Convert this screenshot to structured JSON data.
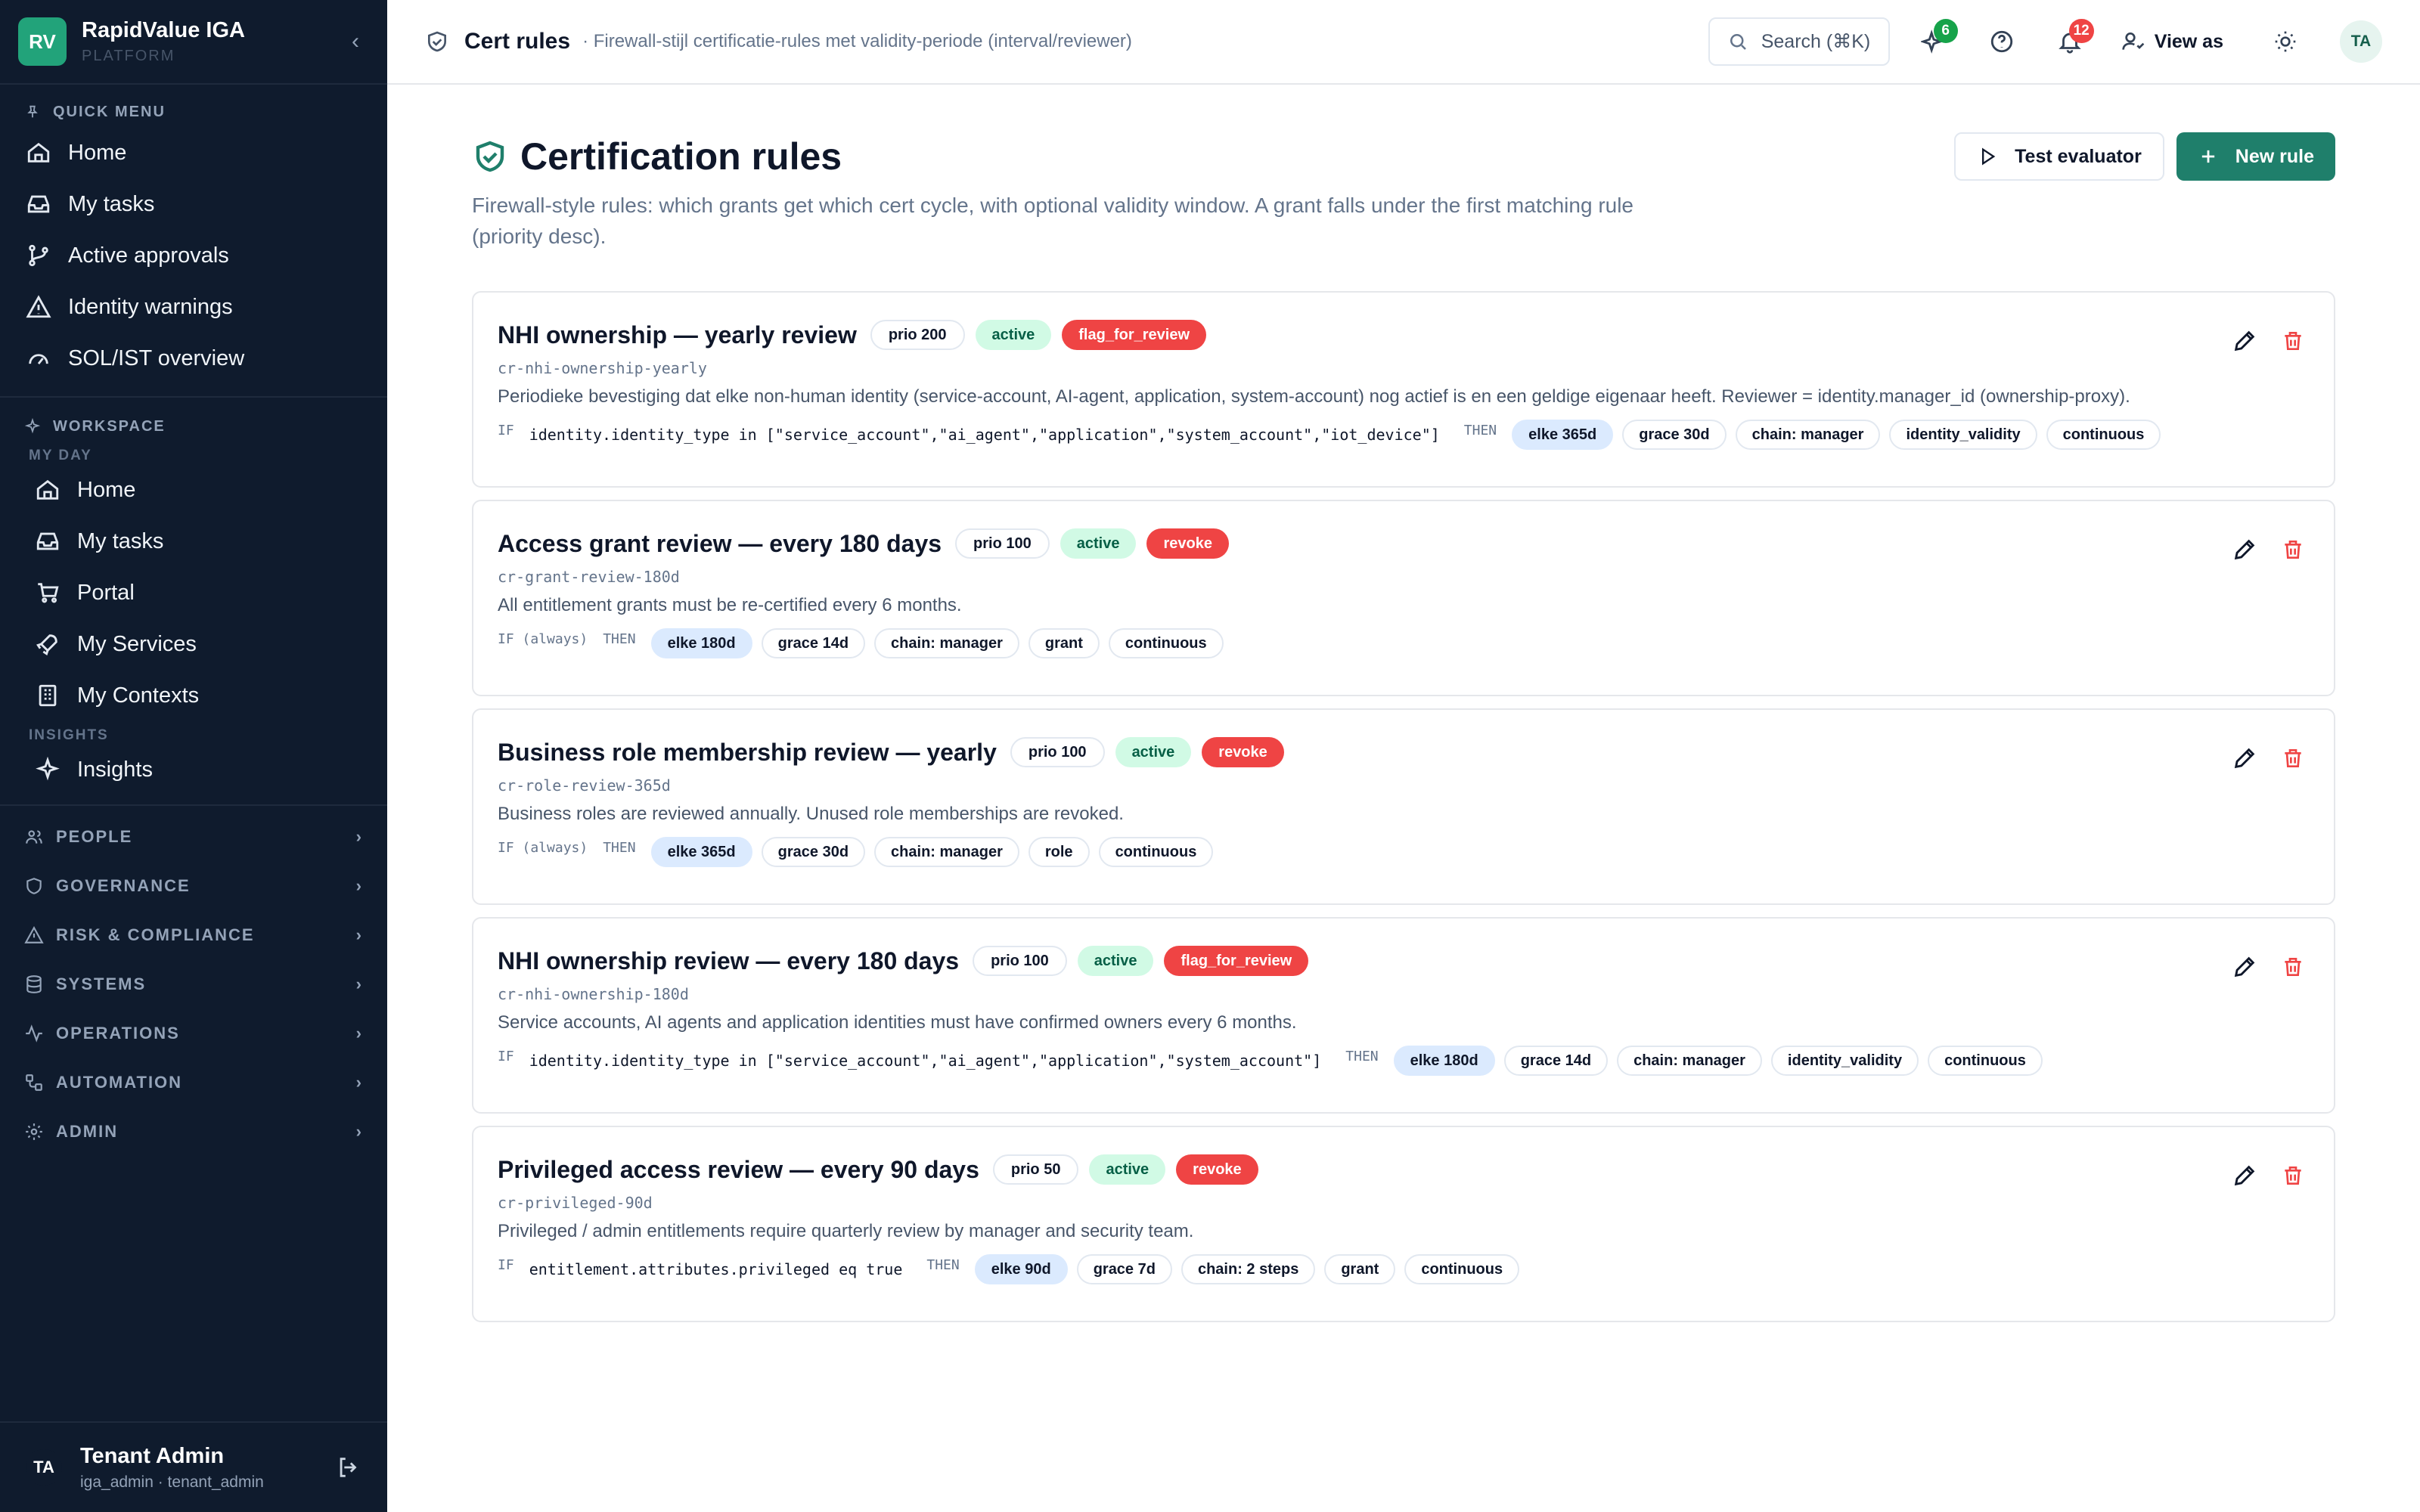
{
  "brand": {
    "initials": "RV",
    "name": "RapidValue IGA",
    "sub": "PLATFORM"
  },
  "sidebar": {
    "quick_label": "QUICK MENU",
    "quick": [
      {
        "label": "Home"
      },
      {
        "label": "My tasks"
      },
      {
        "label": "Active approvals"
      },
      {
        "label": "Identity warnings"
      },
      {
        "label": "SOL/IST overview"
      }
    ],
    "workspace_label": "WORKSPACE",
    "myday_label": "MY DAY",
    "myday": [
      {
        "label": "Home"
      },
      {
        "label": "My tasks"
      },
      {
        "label": "Portal"
      },
      {
        "label": "My Services"
      },
      {
        "label": "My Contexts"
      }
    ],
    "insights_label": "INSIGHTS",
    "insights": [
      {
        "label": "Insights"
      }
    ],
    "groups": [
      {
        "label": "PEOPLE"
      },
      {
        "label": "GOVERNANCE"
      },
      {
        "label": "RISK & COMPLIANCE"
      },
      {
        "label": "SYSTEMS"
      },
      {
        "label": "OPERATIONS"
      },
      {
        "label": "AUTOMATION"
      },
      {
        "label": "ADMIN"
      }
    ]
  },
  "user": {
    "initials": "TA",
    "name": "Tenant Admin",
    "role": "iga_admin · tenant_admin"
  },
  "topbar": {
    "title": "Cert rules",
    "desc": "· Firewall-stijl certificatie-rules met validity-periode (interval/reviewer)",
    "search": "Search (⌘K)",
    "ai_badge": "6",
    "notif_badge": "12",
    "view_as": "View as",
    "avatar": "TA"
  },
  "page": {
    "title": "Certification rules",
    "intro": "Firewall-style rules: which grants get which cert cycle, with optional validity window. A grant falls under the first matching rule (priority desc).",
    "test_btn": "Test evaluator",
    "new_btn": "New rule"
  },
  "rules": [
    {
      "title": "NHI ownership — yearly review",
      "prio": "prio 200",
      "status": "active",
      "action": "flag_for_review",
      "id": "cr-nhi-ownership-yearly",
      "desc": "Periodieke bevestiging dat elke non-human identity (service-account, AI-agent, application, system-account) nog actief is en een geldige eigenaar heeft. Reviewer = identity.manager_id (ownership-proxy).",
      "if": "IF",
      "expr": "identity.identity_type in [\"service_account\",\"ai_agent\",\"application\",\"system_account\",\"iot_device\"]",
      "then": "THEN",
      "chips": [
        "elke 365d",
        "grace 30d",
        "chain: manager",
        "identity_validity",
        "continuous"
      ]
    },
    {
      "title": "Access grant review — every 180 days",
      "prio": "prio 100",
      "status": "active",
      "action": "revoke",
      "id": "cr-grant-review-180d",
      "desc": "All entitlement grants must be re-certified every 6 months.",
      "if": "IF (always)",
      "expr": "",
      "then": "THEN",
      "chips": [
        "elke 180d",
        "grace 14d",
        "chain: manager",
        "grant",
        "continuous"
      ]
    },
    {
      "title": "Business role membership review — yearly",
      "prio": "prio 100",
      "status": "active",
      "action": "revoke",
      "id": "cr-role-review-365d",
      "desc": "Business roles are reviewed annually. Unused role memberships are revoked.",
      "if": "IF (always)",
      "expr": "",
      "then": "THEN",
      "chips": [
        "elke 365d",
        "grace 30d",
        "chain: manager",
        "role",
        "continuous"
      ]
    },
    {
      "title": "NHI ownership review — every 180 days",
      "prio": "prio 100",
      "status": "active",
      "action": "flag_for_review",
      "id": "cr-nhi-ownership-180d",
      "desc": "Service accounts, AI agents and application identities must have confirmed owners every 6 months.",
      "if": "IF",
      "expr": "identity.identity_type in [\"service_account\",\"ai_agent\",\"application\",\"system_account\"]",
      "then": "THEN",
      "chips": [
        "elke 180d",
        "grace 14d",
        "chain: manager",
        "identity_validity",
        "continuous"
      ]
    },
    {
      "title": "Privileged access review — every 90 days",
      "prio": "prio 50",
      "status": "active",
      "action": "revoke",
      "id": "cr-privileged-90d",
      "desc": "Privileged / admin entitlements require quarterly review by manager and security team.",
      "if": "IF",
      "expr": "entitlement.attributes.privileged eq true",
      "then": "THEN",
      "chips": [
        "elke 90d",
        "grace 7d",
        "chain: 2 steps",
        "grant",
        "continuous"
      ]
    }
  ]
}
